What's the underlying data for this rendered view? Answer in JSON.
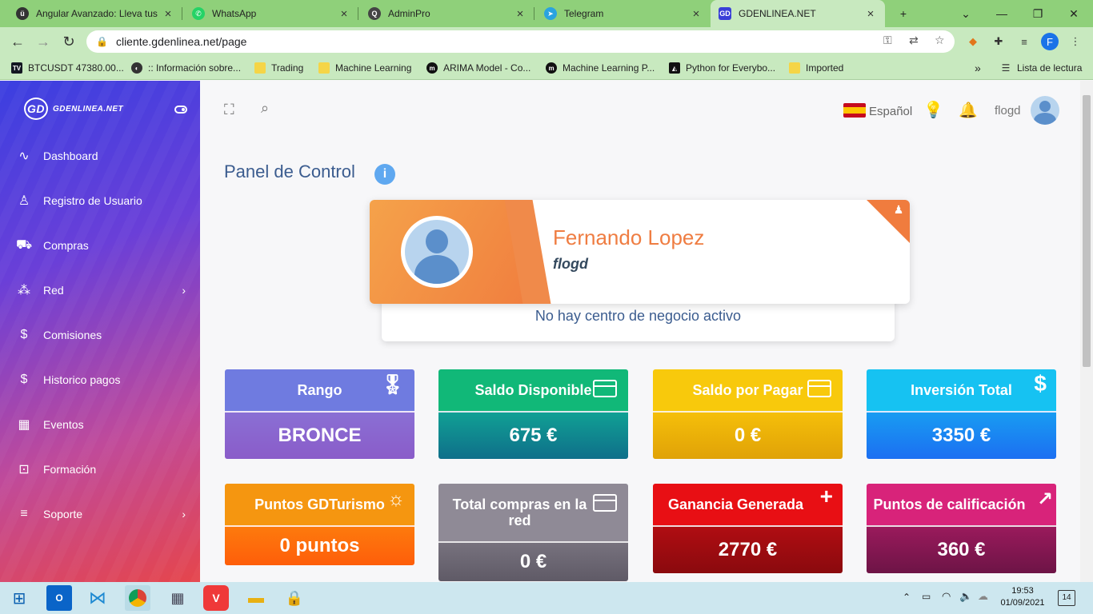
{
  "browser": {
    "tabs": [
      {
        "title": "Angular Avanzado: Lleva tus",
        "icon": "udemy-icon"
      },
      {
        "title": "WhatsApp",
        "icon": "whatsapp-icon"
      },
      {
        "title": "AdminPro",
        "icon": "adminpro-icon"
      },
      {
        "title": "Telegram",
        "icon": "telegram-icon"
      },
      {
        "title": "GDENLINEA.NET",
        "icon": "gd-icon"
      }
    ],
    "new_tab": "+",
    "url": "cliente.gdenlinea.net/page",
    "profile_initial": "F",
    "bookmarks": [
      {
        "label": "BTCUSDT 47380.00...",
        "icon": "tradingview-icon"
      },
      {
        "label": ":: Información sobre...",
        "icon": "globe-icon"
      },
      {
        "label": "Trading",
        "icon": "folder-icon"
      },
      {
        "label": "Machine Learning",
        "icon": "folder-icon"
      },
      {
        "label": "ARIMA Model - Co...",
        "icon": "medium-icon"
      },
      {
        "label": "Machine Learning P...",
        "icon": "medium-icon"
      },
      {
        "label": "Python for Everybo...",
        "icon": "coursera-icon"
      },
      {
        "label": "Imported",
        "icon": "folder-icon"
      }
    ],
    "more_bookmarks": "»",
    "reading_list": "Lista de lectura"
  },
  "sidebar": {
    "brand": "GDENLINEA.NET",
    "brand_mark": "GD",
    "items": [
      {
        "label": "Dashboard",
        "icon": "activity-icon",
        "has_submenu": false
      },
      {
        "label": "Registro de Usuario",
        "icon": "user-icon",
        "has_submenu": false
      },
      {
        "label": "Compras",
        "icon": "cart-icon",
        "has_submenu": false
      },
      {
        "label": "Red",
        "icon": "network-icon",
        "has_submenu": true
      },
      {
        "label": "Comisiones",
        "icon": "dollar-icon",
        "has_submenu": false
      },
      {
        "label": "Historico pagos",
        "icon": "dollar-icon",
        "has_submenu": false
      },
      {
        "label": "Eventos",
        "icon": "calendar-icon",
        "has_submenu": false
      },
      {
        "label": "Formación",
        "icon": "book-icon",
        "has_submenu": false
      },
      {
        "label": "Soporte",
        "icon": "list-icon",
        "has_submenu": true
      }
    ]
  },
  "header": {
    "language": "Español",
    "username": "flogd"
  },
  "page": {
    "title": "Panel de Control",
    "info_icon": "i"
  },
  "profile": {
    "name": "Fernando Lopez",
    "username": "flogd",
    "business_center_status": "No hay centro de negocio activo"
  },
  "cards": [
    {
      "label": "Rango",
      "value": "BRONCE",
      "icon": "award-icon",
      "color_top": "#6f7be0",
      "color_bottom": "#8a5cc9"
    },
    {
      "label": "Saldo Disponible",
      "value": "675 €",
      "icon": "credit-card-icon",
      "color_top": "#11b878",
      "color_bottom": "#0f6f8a"
    },
    {
      "label": "Saldo por Pagar",
      "value": "0 €",
      "icon": "credit-card-icon",
      "color_top": "#f8c90c",
      "color_bottom": "#e8a707"
    },
    {
      "label": "Inversión Total",
      "value": "3350 €",
      "icon": "dollar-icon",
      "color_top": "#16c2f2",
      "color_bottom": "#1c6ff2"
    },
    {
      "label": "Puntos GDTurismo",
      "value": "0 puntos",
      "icon": "sun-icon",
      "color_top": "#f59610",
      "color_bottom": "#fe5e0a"
    },
    {
      "label": "Total compras en la red",
      "value": "0 €",
      "icon": "credit-card-icon",
      "color_top": "#8f8a96",
      "color_bottom": "#5f5a66"
    },
    {
      "label": "Ganancia Generada",
      "value": "2770 €",
      "icon": "plus-icon",
      "color_top": "#e80f14",
      "color_bottom": "#8a0a0e"
    },
    {
      "label": "Puntos de calificación",
      "value": "360 €",
      "icon": "trending-up-icon",
      "color_top": "#d8237a",
      "color_bottom": "#6d1446"
    }
  ],
  "taskbar": {
    "time": "19:53",
    "date": "01/09/2021",
    "notifications": "14"
  }
}
